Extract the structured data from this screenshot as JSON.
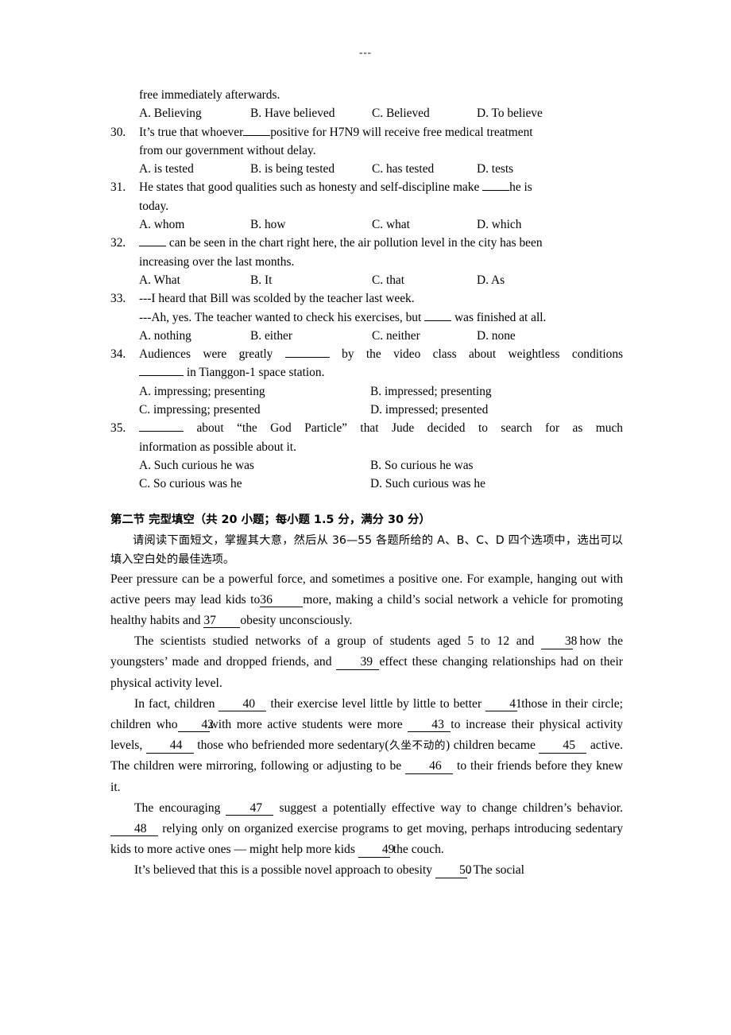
{
  "page": {
    "top_mark": "---"
  },
  "questions": [
    {
      "id": "q29-tail",
      "number": "",
      "stem_tail": "free immediately afterwards.",
      "options": [
        "A. Believing",
        "B. Have believed",
        "C. Believed",
        "D. To believe"
      ],
      "option_layout": "four"
    },
    {
      "id": "q30",
      "number": "30.",
      "line1_pre": "It’s true that whoever",
      "line1_post": "positive for H7N9 will receive free medical treatment",
      "line2": "from our government without delay.",
      "blank": "",
      "options": [
        "A. is tested",
        "B. is being tested",
        "C. has tested",
        "D. tests"
      ],
      "option_layout": "four"
    },
    {
      "id": "q31",
      "number": "31.",
      "line1_pre": "He states that good qualities such as honesty and self-discipline make",
      "line1_post": "he is",
      "line2": "today.",
      "blank": "",
      "options": [
        "A. whom",
        "B. how",
        "C. what",
        "D. which"
      ],
      "option_layout": "four"
    },
    {
      "id": "q32",
      "number": "32.",
      "line1_pre": "",
      "line1_post": "can be seen in the chart right here, the air pollution level in the city has been",
      "line2": "increasing over the last months.",
      "blank": "",
      "options": [
        "A. What",
        "B. It",
        "C. that",
        "D. As"
      ],
      "option_layout": "four"
    },
    {
      "id": "q33",
      "number": "33.",
      "line1": "---I heard that Bill was scolded by the teacher last week.",
      "line2_pre": "---Ah, yes. The teacher wanted to check his exercises, but",
      "line2_post": "was finished at all.",
      "blank": "",
      "options": [
        "A. nothing",
        "B. either",
        "C. neither",
        "D. none"
      ],
      "option_layout": "four"
    },
    {
      "id": "q34",
      "number": "34.",
      "line1_pre": "Audiences were greatly",
      "line1_post": "by the video class about weightless conditions",
      "line2_post": "in Tianggon-1 space station.",
      "blank": "",
      "options": [
        "A. impressing; presenting",
        "B. impressed; presenting",
        "C. impressing; presented",
        "D. impressed; presented"
      ],
      "option_layout": "two"
    },
    {
      "id": "q35",
      "number": "35.",
      "line1_post": "about “the God Particle” that Jude decided to search for as much",
      "line2": "information as possible about it.",
      "blank": "",
      "options": [
        "A. Such curious he was",
        "B. So curious he was",
        "C. So curious was he",
        "D. Such curious was he"
      ],
      "option_layout": "two"
    }
  ],
  "section2": {
    "heading": "第二节 完型填空（共 20 小题；每小题 1.5 分，满分 30 分）",
    "instruction": "请阅读下面短文，掌握其大意，然后从 36—55 各题所给的 A、B、C、D 四个选项中，选出可以填入空白处的最佳选项。"
  },
  "passage": {
    "para1": {
      "t1": "Peer pressure can be a powerful force, and sometimes a positive one. For example, hanging out with active peers may lead kids to",
      "b36": "36",
      "t2": "more, making a child’s social network a vehicle for promoting healthy habits and",
      "b37": "37",
      "t3": "obesity unconsciously."
    },
    "para2": {
      "t1": "The scientists studied networks of a group of students aged 5 to 12 and",
      "b38": "38",
      "t2": "how the youngsters’ made and dropped friends, and",
      "b39": "39",
      "t3": "effect these changing relationships had on their physical activity level."
    },
    "para3": {
      "t1": "In fact, children",
      "b40": "40",
      "t2": "their exercise level little by little to better",
      "b41": "41",
      "t3": "those in their circle; children who",
      "b42": "42",
      "t4": "with more active students were more",
      "b43": "43",
      "t5": "to increase their physical activity levels,",
      "b44": "44",
      "t6": "those who befriended more sedentary(",
      "cn_gloss": "久坐不动的",
      "t7": ") children became",
      "b45": "45",
      "t8": "active. The children were mirroring, following or adjusting to be",
      "b46": "46",
      "t9": "to their friends before they knew it."
    },
    "para4": {
      "t1": "The encouraging",
      "b47": "47",
      "t2": "suggest a potentially effective way to change children’s behavior.",
      "b48": "48",
      "t3": "relying only on organized exercise programs to get moving, perhaps introducing sedentary kids to more active ones — might help more kids",
      "b49": "49",
      "t4": "the couch."
    },
    "para5": {
      "t1": "It’s believed that this is a possible novel approach to obesity",
      "b50": "50",
      "t2": ". The social"
    }
  }
}
